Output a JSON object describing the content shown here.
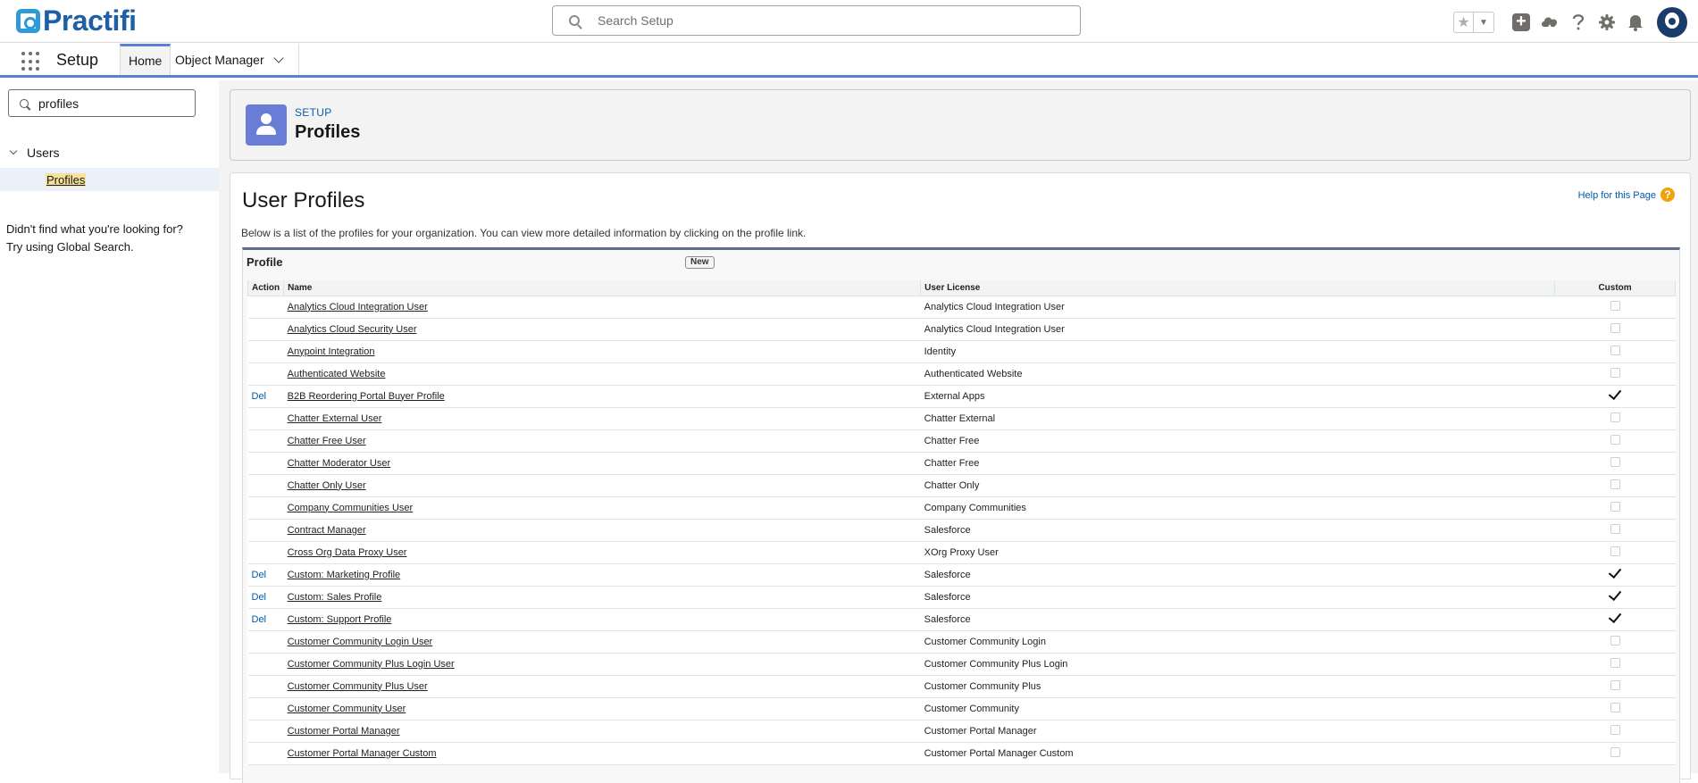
{
  "brand": {
    "name": "Practifi"
  },
  "global_search": {
    "placeholder": "Search Setup"
  },
  "nav": {
    "app_name": "Setup",
    "tabs": [
      {
        "label": "Home",
        "active": true
      },
      {
        "label": "Object Manager",
        "active": false
      }
    ]
  },
  "sidebar": {
    "quickfind_value": "profiles",
    "group_label": "Users",
    "selected_item": "Profiles",
    "not_found_line1": "Didn't find what you're looking for?",
    "not_found_line2": "Try using Global Search."
  },
  "setup_header": {
    "eyebrow": "SETUP",
    "title": "Profiles"
  },
  "page": {
    "title": "User Profiles",
    "help_link": "Help for this Page",
    "intro": "Below is a list of the profiles for your organization. You can view more detailed information by clicking on the profile link."
  },
  "panel": {
    "title": "Profile",
    "new_button": "New",
    "columns": {
      "action": "Action",
      "name": "Name",
      "license": "User License",
      "custom": "Custom"
    },
    "rows": [
      {
        "action": "",
        "name": "Analytics Cloud Integration User",
        "license": "Analytics Cloud Integration User",
        "custom": false
      },
      {
        "action": "",
        "name": "Analytics Cloud Security User",
        "license": "Analytics Cloud Integration User",
        "custom": false
      },
      {
        "action": "",
        "name": "Anypoint Integration",
        "license": "Identity",
        "custom": false
      },
      {
        "action": "",
        "name": "Authenticated Website",
        "license": "Authenticated Website",
        "custom": false
      },
      {
        "action": "Del",
        "name": "B2B Reordering Portal Buyer Profile",
        "license": "External Apps",
        "custom": true
      },
      {
        "action": "",
        "name": "Chatter External User",
        "license": "Chatter External",
        "custom": false
      },
      {
        "action": "",
        "name": "Chatter Free User",
        "license": "Chatter Free",
        "custom": false
      },
      {
        "action": "",
        "name": "Chatter Moderator User",
        "license": "Chatter Free",
        "custom": false
      },
      {
        "action": "",
        "name": "Chatter Only User",
        "license": "Chatter Only",
        "custom": false
      },
      {
        "action": "",
        "name": "Company Communities User",
        "license": "Company Communities",
        "custom": false
      },
      {
        "action": "",
        "name": "Contract Manager",
        "license": "Salesforce",
        "custom": false
      },
      {
        "action": "",
        "name": "Cross Org Data Proxy User",
        "license": "XOrg Proxy User",
        "custom": false
      },
      {
        "action": "Del",
        "name": "Custom: Marketing Profile",
        "license": "Salesforce",
        "custom": true
      },
      {
        "action": "Del",
        "name": "Custom: Sales Profile",
        "license": "Salesforce",
        "custom": true
      },
      {
        "action": "Del",
        "name": "Custom: Support Profile",
        "license": "Salesforce",
        "custom": true
      },
      {
        "action": "",
        "name": "Customer Community Login User",
        "license": "Customer Community Login",
        "custom": false
      },
      {
        "action": "",
        "name": "Customer Community Plus Login User",
        "license": "Customer Community Plus Login",
        "custom": false
      },
      {
        "action": "",
        "name": "Customer Community Plus User",
        "license": "Customer Community Plus",
        "custom": false
      },
      {
        "action": "",
        "name": "Customer Community User",
        "license": "Customer Community",
        "custom": false
      },
      {
        "action": "",
        "name": "Customer Portal Manager",
        "license": "Customer Portal Manager",
        "custom": false
      },
      {
        "action": "",
        "name": "Customer Portal Manager Custom",
        "license": "Customer Portal Manager Custom",
        "custom": false
      }
    ]
  },
  "icons": {
    "favorites": "star-icon",
    "favorites_menu": "chevron-down-icon",
    "add": "plus-icon",
    "trailhead": "cloud-icon",
    "help": "question-icon",
    "setup": "gear-icon",
    "notifications": "bell-icon",
    "user": "avatar"
  },
  "colors": {
    "accent": "#5b7fd4",
    "link": "#015ba7",
    "brand": "#1f5fa8",
    "setup_icon": "#6a7dd6"
  }
}
